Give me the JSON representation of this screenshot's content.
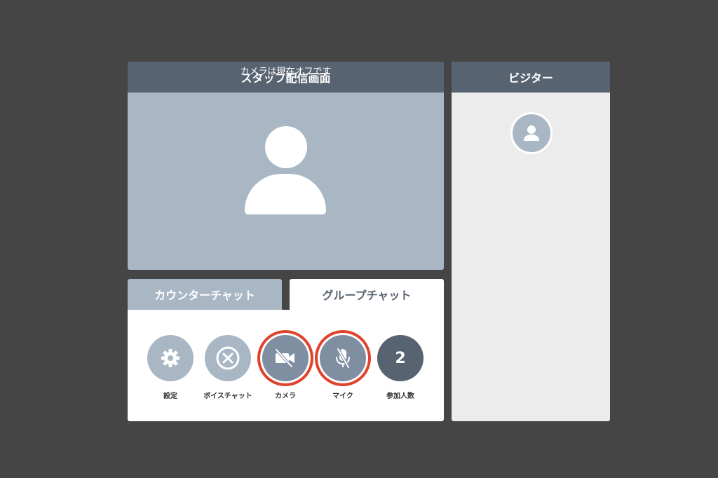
{
  "staff_panel": {
    "title": "スタッフ配信画面",
    "camera_off_text": "カメラは現在オフです"
  },
  "visitor_panel": {
    "title": "ビジター"
  },
  "chat_tabs": [
    {
      "label": "カウンターチャット",
      "active": false
    },
    {
      "label": "グループチャット",
      "active": true
    }
  ],
  "controls": {
    "settings_label": "設定",
    "voice_chat_label": "ボイスチャット",
    "camera_label": "カメラ",
    "mic_label": "マイク",
    "participants_label": "参加人数",
    "participants_count": "2"
  },
  "colors": {
    "background": "#454545",
    "header": "#586371",
    "avatar_bg": "#a9b7c5",
    "alert_ring": "#e0432c"
  },
  "icons": {
    "settings": "gear-icon",
    "voice_chat": "close-circle-icon",
    "camera": "camera-off-icon",
    "mic": "mic-off-icon"
  }
}
